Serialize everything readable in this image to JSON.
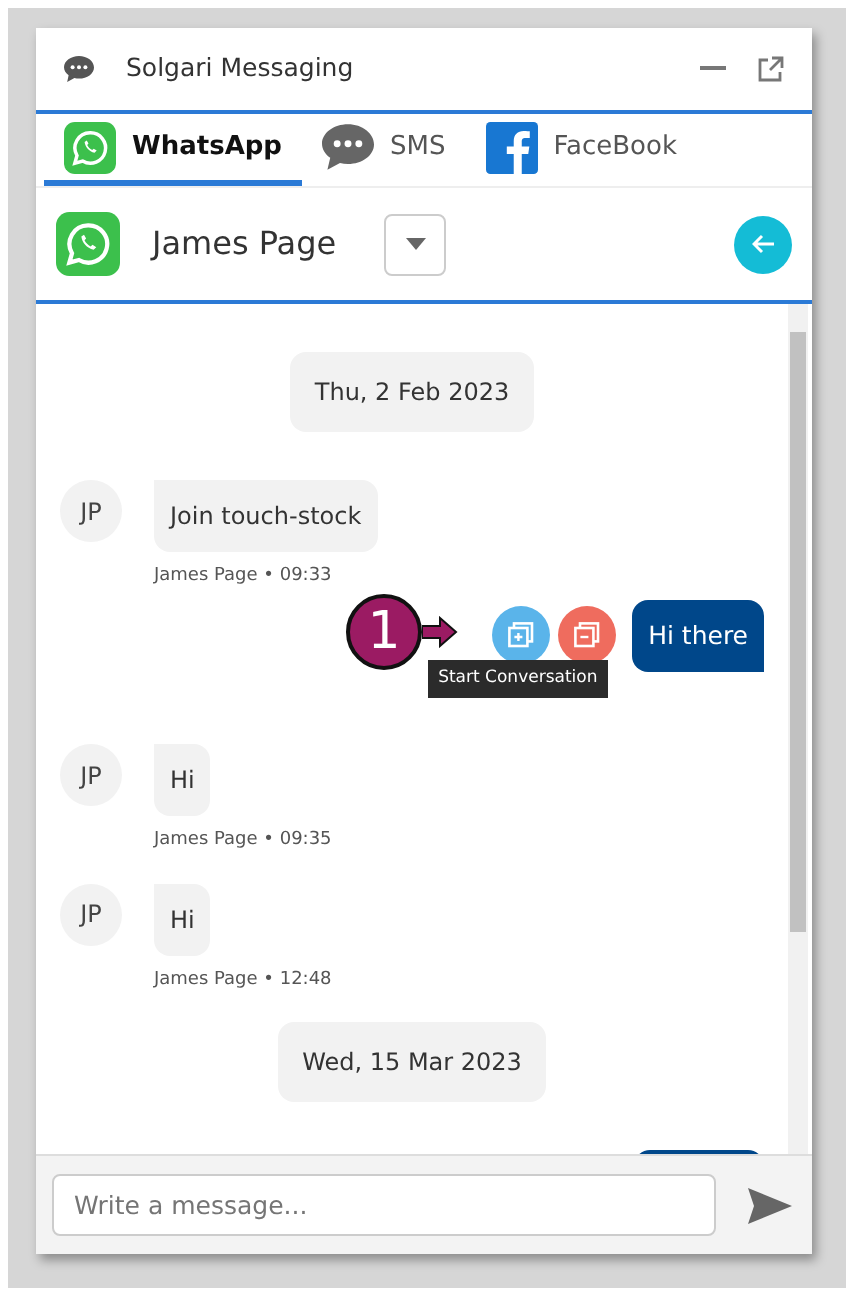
{
  "window": {
    "title": "Solgari Messaging"
  },
  "tabs": [
    {
      "label": "WhatsApp",
      "kind": "whatsapp",
      "selected": true
    },
    {
      "label": "SMS",
      "kind": "sms",
      "selected": false
    },
    {
      "label": "FaceBook",
      "kind": "facebook",
      "selected": false
    }
  ],
  "contact": {
    "name": "James Page"
  },
  "messages": [
    {
      "kind": "date",
      "text": "Thu, 2 Feb 2023"
    },
    {
      "kind": "incoming",
      "initials": "JP",
      "text": "Join touch-stock",
      "meta": "James Page • 09:33"
    },
    {
      "kind": "outgoing",
      "text": "Hi there",
      "tooltip": "Start Conversation"
    },
    {
      "kind": "incoming",
      "initials": "JP",
      "text": "Hi",
      "meta": "James Page • 09:35"
    },
    {
      "kind": "incoming",
      "initials": "JP",
      "text": "Hi",
      "meta": "James Page • 12:48"
    },
    {
      "kind": "date",
      "text": "Wed, 15 Mar 2023"
    },
    {
      "kind": "outgoing_partial"
    }
  ],
  "callout": {
    "number": "1"
  },
  "composer": {
    "placeholder": "Write a message..."
  }
}
